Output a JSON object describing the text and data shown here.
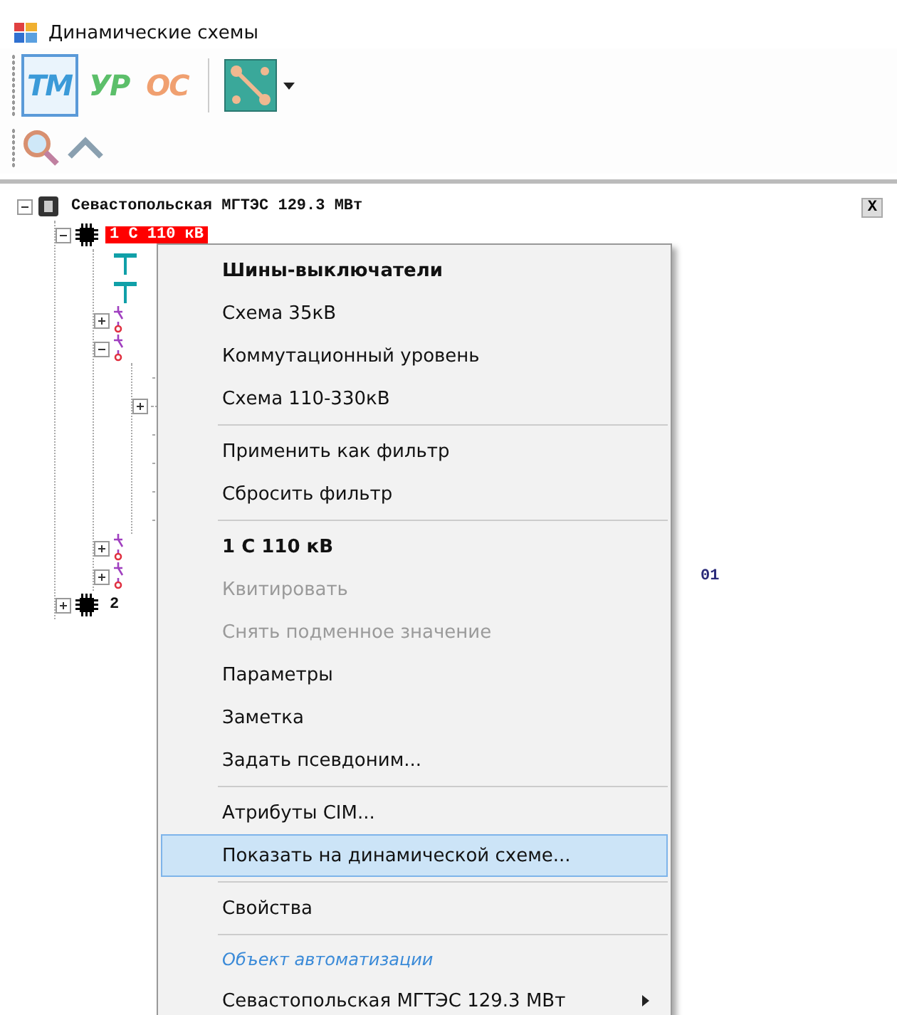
{
  "window": {
    "title": "Динамические схемы"
  },
  "toolbar": {
    "modes": [
      {
        "label": "ТМ",
        "selected": true,
        "color": "#3b9ad8"
      },
      {
        "label": "УР",
        "selected": false,
        "color": "#5cbf6a"
      },
      {
        "label": "ОС",
        "selected": false,
        "color": "#f0a070"
      }
    ]
  },
  "panel": {
    "close": "X"
  },
  "tree": [
    {
      "kind": "station",
      "label": "Севастопольская МГТЭС 129.3 МВт",
      "expanded": true,
      "selected": false,
      "children": [
        {
          "kind": "chip",
          "label": "1 С 110 кВ",
          "expanded": true,
          "selected": true,
          "children": [
            {
              "kind": "bus"
            },
            {
              "kind": "bus"
            },
            {
              "kind": "switch",
              "expanded": false
            },
            {
              "kind": "switch",
              "expanded": true,
              "children": [
                {
                  "kind": "line"
                },
                {
                  "kind": "line",
                  "expanded": false
                },
                {
                  "kind": "line"
                },
                {
                  "kind": "line"
                },
                {
                  "kind": "line"
                },
                {
                  "kind": "line"
                }
              ]
            },
            {
              "kind": "switch",
              "expanded": false
            },
            {
              "kind": "switch",
              "expanded": false,
              "selected": false,
              "label": "01"
            }
          ]
        },
        {
          "kind": "chip",
          "label": "2",
          "expanded": false,
          "selected": false
        }
      ]
    }
  ],
  "context_menu": [
    {
      "kind": "item",
      "label": "Шины-выключатели",
      "bold": true,
      "disabled": false,
      "selected": false
    },
    {
      "kind": "item",
      "label": "Схема 35кВ",
      "bold": false,
      "disabled": false,
      "selected": false
    },
    {
      "kind": "item",
      "label": "Коммутационный уровень",
      "bold": false,
      "disabled": false,
      "selected": false
    },
    {
      "kind": "item",
      "label": "Схема 110-330кВ",
      "bold": false,
      "disabled": false,
      "selected": false
    },
    {
      "kind": "separator"
    },
    {
      "kind": "item",
      "label": "Применить как фильтр",
      "bold": false,
      "disabled": false,
      "selected": false
    },
    {
      "kind": "item",
      "label": "Сбросить фильтр",
      "bold": false,
      "disabled": false,
      "selected": false
    },
    {
      "kind": "separator"
    },
    {
      "kind": "item",
      "label": "1 С 110 кВ",
      "bold": true,
      "disabled": false,
      "selected": false
    },
    {
      "kind": "item",
      "label": "Квитировать",
      "bold": false,
      "disabled": true,
      "selected": false
    },
    {
      "kind": "item",
      "label": "Снять подменное значение",
      "bold": false,
      "disabled": true,
      "selected": false
    },
    {
      "kind": "item",
      "label": "Параметры",
      "bold": false,
      "disabled": false,
      "selected": false
    },
    {
      "kind": "item",
      "label": "Заметка",
      "bold": false,
      "disabled": false,
      "selected": false
    },
    {
      "kind": "item",
      "label": "Задать псевдоним...",
      "bold": false,
      "disabled": false,
      "selected": false
    },
    {
      "kind": "separator"
    },
    {
      "kind": "item",
      "label": "Атрибуты CIM...",
      "bold": false,
      "disabled": false,
      "selected": false
    },
    {
      "kind": "item",
      "label": "Показать на динамической схеме...",
      "bold": false,
      "disabled": false,
      "selected": true
    },
    {
      "kind": "separator"
    },
    {
      "kind": "item",
      "label": "Свойства",
      "bold": false,
      "disabled": false,
      "selected": false
    },
    {
      "kind": "separator"
    },
    {
      "kind": "caption",
      "label": "Объект автоматизации"
    },
    {
      "kind": "submenu",
      "label": "Севастопольская МГТЭС 129.3 МВт",
      "bold": false,
      "disabled": false,
      "selected": false
    }
  ]
}
